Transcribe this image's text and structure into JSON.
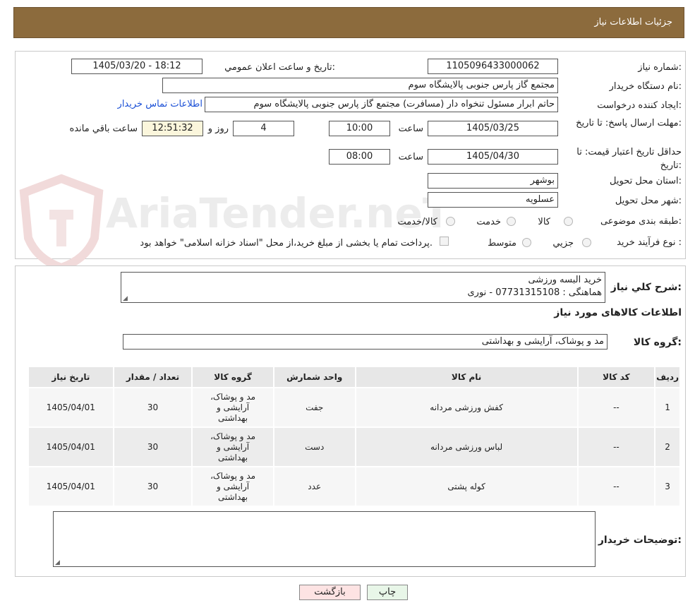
{
  "header": {
    "title": "جزئیات اطلاعات نیاز"
  },
  "watermark": {
    "text": "AriaTender.neT"
  },
  "form": {
    "need_number": {
      "label": "شماره نیاز:",
      "value": "1105096433000062"
    },
    "announce_datetime": {
      "label": "تاریخ و ساعت اعلان عمومي:",
      "value": "1405/03/20 - 18:12"
    },
    "buyer_org": {
      "label": "نام دستگاه خريدار:",
      "value": "مجتمع گاز پارس جنوبی  پالایشگاه سوم"
    },
    "requester": {
      "label": "ايجاد کننده درخواست:",
      "value": "حاتم ابرار مسئول تنخواه دار  (مسافرت) مجتمع گاز پارس جنوبی  پالایشگاه سوم",
      "contact_link": "اطلاعات تماس خريدار"
    },
    "reply_deadline": {
      "label": "مهلت ارسال پاسخ: تا تاریخ:",
      "date": "1405/03/25",
      "time_label": "ساعت",
      "time": "10:00",
      "days": "4",
      "days_label": "روز و",
      "remaining": "12:51:32",
      "remaining_label": "ساعت باقي مانده"
    },
    "price_validity": {
      "label": "حداقل تاریخ اعتبار قیمت: تا تاریخ:",
      "date": "1405/04/30",
      "time_label": "ساعت",
      "time": "08:00"
    },
    "province": {
      "label": "استان محل تحويل:",
      "value": "بوشهر"
    },
    "city": {
      "label": "شهر محل تحويل:",
      "value": "عسلویه"
    },
    "category": {
      "label": "طبقه بندی موضوعی:",
      "options": [
        "کالا",
        "خدمت",
        "کالا/خدمت"
      ]
    },
    "process_type": {
      "label": "نوع فرآيند خريد :",
      "options": [
        "جزیي",
        "متوسط"
      ],
      "note": "پرداخت تمام یا بخشی از مبلغ خرید،از محل \"اسناد خزانه اسلامی\" خواهد بود."
    }
  },
  "summary": {
    "label": "شرح كلي نياز:",
    "line1": "خرید البسه ورزشی",
    "line2": "هماهنگی : 07731315108 - نوری"
  },
  "goods_section": {
    "title": "اطلاعات کالاهای مورد نیاز",
    "group_label": "گروه کالا:",
    "group_value": "مد و پوشاک، آرایشی و بهداشتی"
  },
  "table": {
    "headers": {
      "row": "رديف",
      "code": "کد کالا",
      "name": "نام کالا",
      "unit": "واحد شمارش",
      "group": "گروه کالا",
      "qty": "تعداد / مقدار",
      "date": "تاریخ نیاز"
    },
    "rows": [
      {
        "row": "1",
        "code": "--",
        "name": "کفش ورزشی مردانه",
        "unit": "جفت",
        "group": "مد و پوشاک، آرایشی و بهداشتی",
        "qty": "30",
        "date": "1405/04/01"
      },
      {
        "row": "2",
        "code": "--",
        "name": "لباس ورزشی مردانه",
        "unit": "دست",
        "group": "مد و پوشاک، آرایشی و بهداشتی",
        "qty": "30",
        "date": "1405/04/01"
      },
      {
        "row": "3",
        "code": "--",
        "name": "کوله پشتی",
        "unit": "عدد",
        "group": "مد و پوشاک، آرایشی و بهداشتی",
        "qty": "30",
        "date": "1405/04/01"
      }
    ]
  },
  "buyer_notes": {
    "label": "توضیحات خریدار:",
    "value": ""
  },
  "buttons": {
    "print": "چاپ",
    "back": "بازگشت"
  },
  "colors": {
    "header_bg": "#8c6b3d",
    "remaining_bg": "#fbf6dc",
    "back_btn_bg": "#fde3e3",
    "print_btn_bg": "#e8f6e8",
    "link": "#1a4fd6"
  }
}
